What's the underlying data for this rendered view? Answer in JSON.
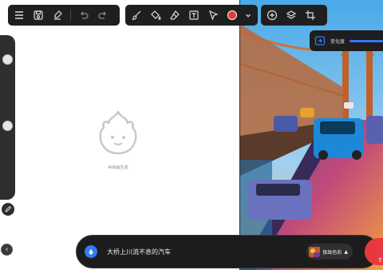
{
  "toolbar_left": {
    "items": [
      "menu-icon",
      "save-icon",
      "clear-icon",
      "undo-icon",
      "redo-icon"
    ]
  },
  "toolbar_mid": {
    "items": [
      "brush-icon",
      "fill-icon",
      "eraser-icon",
      "text-box-icon",
      "select-icon",
      "color-swatch",
      "color-dropdown"
    ],
    "current_color": "#e53935"
  },
  "toolbar_right": {
    "items": [
      "add-icon",
      "layers-icon",
      "crop-icon"
    ]
  },
  "canvas": {
    "mascot_caption": "AI绘画生成"
  },
  "degree_panel": {
    "label": "变化度"
  },
  "prompt_bar": {
    "text": "大桥上川流不息的汽车",
    "style_label": "极致色彩",
    "style_arrow": "▲",
    "generate_label": "生"
  },
  "colors": {
    "accent": "#2f7cf6",
    "generate": "#e8383d",
    "toolbar_bg": "#1f1f1f"
  }
}
